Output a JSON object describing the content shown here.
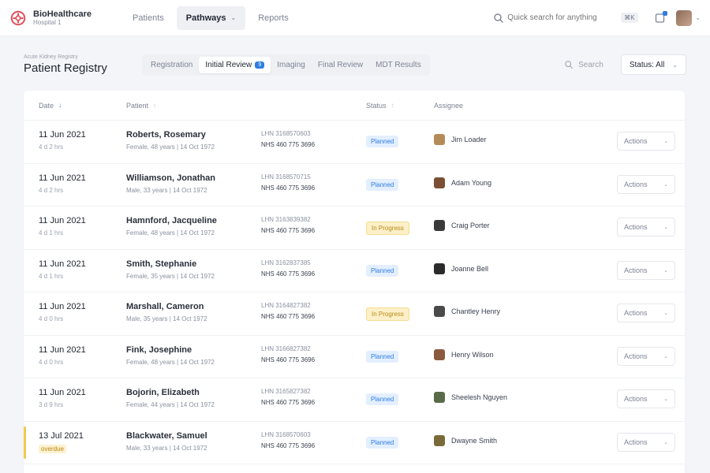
{
  "brand": {
    "name": "BioHealthcare",
    "sub": "Hospital 1"
  },
  "nav": [
    {
      "label": "Patients",
      "active": false
    },
    {
      "label": "Pathways",
      "active": true
    },
    {
      "label": "Reports",
      "active": false
    }
  ],
  "global_search": {
    "placeholder": "Quick search for anything",
    "shortcut": "⌘K"
  },
  "notifications": {
    "icon": "bell-icon",
    "unread": true
  },
  "header": {
    "breadcrumb": "Acute Kidney Registry",
    "title": "Patient Registry",
    "tabs": [
      {
        "label": "Registration",
        "active": false,
        "count": ""
      },
      {
        "label": "Initial Review",
        "active": true,
        "count": "9"
      },
      {
        "label": "Imaging",
        "active": false,
        "count": ""
      },
      {
        "label": "Final Review",
        "active": false,
        "count": ""
      },
      {
        "label": "MDT Results",
        "active": false,
        "count": ""
      }
    ],
    "search_label": "Search",
    "select_label": "Status: All"
  },
  "table": {
    "columns": {
      "date": "Date",
      "patient": "Patient",
      "status": "Status",
      "assignee": "Assignee"
    },
    "action_label": "Actions",
    "rows": [
      {
        "date": "11 Jun 2021",
        "age": "4 d 2 hrs",
        "name": "Roberts, Rosemary",
        "meta": "Female, 48 years | 14 Oct 1972",
        "mrn": "LHN 3168570603",
        "nhs": "NHS 460 775 3696",
        "status": "Planned",
        "status_tone": "blue",
        "assignee": "Jim Loader",
        "avatar": "#b58b57",
        "flag": false
      },
      {
        "date": "11 Jun 2021",
        "age": "4 d 2 hrs",
        "name": "Williamson, Jonathan",
        "meta": "Male, 33 years | 14 Oct 1972",
        "mrn": "LHN 3168570715",
        "nhs": "NHS 460 775 3696",
        "status": "Planned",
        "status_tone": "blue",
        "assignee": "Adam Young",
        "avatar": "#7a4f33",
        "flag": false
      },
      {
        "date": "11 Jun 2021",
        "age": "4 d 1 hrs",
        "name": "Hamnford, Jacqueline",
        "meta": "Female, 48 years | 14 Oct 1972",
        "mrn": "LHN 3163839382",
        "nhs": "NHS 460 775 3696",
        "status": "In Progress",
        "status_tone": "yellow",
        "assignee": "Craig Porter",
        "avatar": "#3a3a3a",
        "flag": false
      },
      {
        "date": "11 Jun 2021",
        "age": "4 d 1 hrs",
        "name": "Smith, Stephanie",
        "meta": "Female, 35 years | 14 Oct 1972",
        "mrn": "LHN 3162837385",
        "nhs": "NHS 460 775 3696",
        "status": "Planned",
        "status_tone": "blue",
        "assignee": "Joanne Bell",
        "avatar": "#2b2b2b",
        "flag": false
      },
      {
        "date": "11 Jun 2021",
        "age": "4 d 0 hrs",
        "name": "Marshall, Cameron",
        "meta": "Male, 35 years | 14 Oct 1972",
        "mrn": "LHN 3164827382",
        "nhs": "NHS 460 775 3696",
        "status": "In Progress",
        "status_tone": "yellow",
        "assignee": "Chantley Henry",
        "avatar": "#4a4a4a",
        "flag": false
      },
      {
        "date": "11 Jun 2021",
        "age": "4 d 0 hrs",
        "name": "Fink, Josephine",
        "meta": "Female, 48 years | 14 Oct 1972",
        "mrn": "LHN 3166827382",
        "nhs": "NHS 460 775 3696",
        "status": "Planned",
        "status_tone": "blue",
        "assignee": "Henry Wilson",
        "avatar": "#8b5a3c",
        "flag": false
      },
      {
        "date": "11 Jun 2021",
        "age": "3 d 9 hrs",
        "name": "Bojorin, Elizabeth",
        "meta": "Female, 44 years | 14 Oct 1972",
        "mrn": "LHN 3165827382",
        "nhs": "NHS 460 775 3696",
        "status": "Planned",
        "status_tone": "blue",
        "assignee": "Sheelesh Nguyen",
        "avatar": "#5a6b4a",
        "flag": false
      },
      {
        "date": "13 Jul 2021",
        "age": "overdue",
        "name": "Blackwater, Samuel",
        "meta": "Male, 33 years | 14 Oct 1972",
        "mrn": "LHN 3168570603",
        "nhs": "NHS 460 775 3696",
        "status": "Planned",
        "status_tone": "blue",
        "assignee": "Dwayne Smith",
        "avatar": "#7a6a3a",
        "flag": true
      }
    ]
  }
}
